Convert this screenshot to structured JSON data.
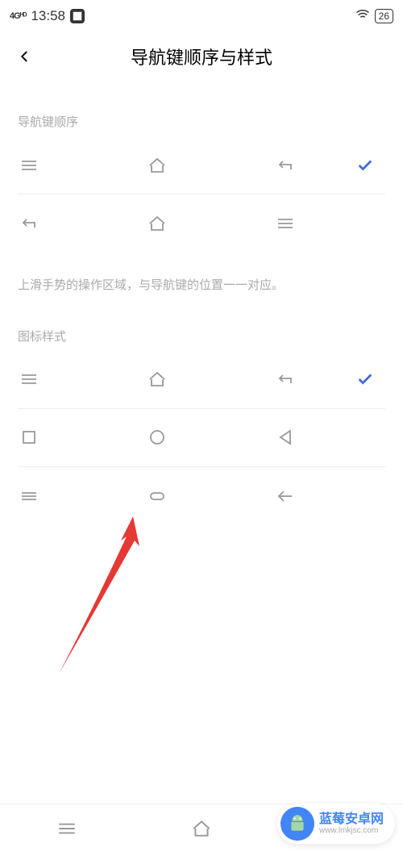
{
  "status_bar": {
    "signal_label": "4G HD",
    "time": "13:58",
    "battery": "26"
  },
  "header": {
    "title": "导航键顺序与样式"
  },
  "sections": {
    "order_label": "导航键顺序",
    "description": "上滑手势的操作区域，与导航键的位置一一对应。",
    "style_label": "图标样式"
  },
  "watermark": {
    "title": "蓝莓安卓网",
    "url": "www.lmkjsc.com"
  }
}
